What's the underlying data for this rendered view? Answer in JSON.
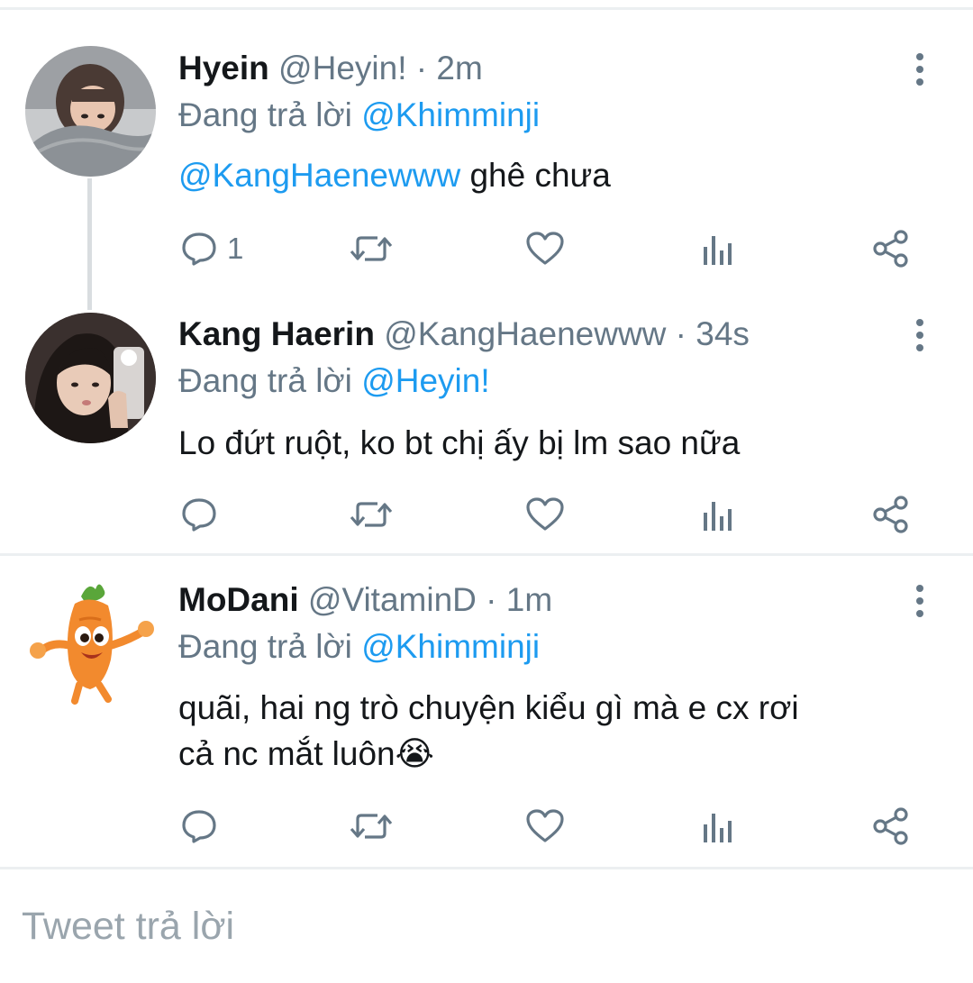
{
  "tweets": [
    {
      "name": "Hyein",
      "handle": "@Heyin!",
      "time": "2m",
      "replying_prefix": "Đang trả lời ",
      "replying_to": "@Khimminji",
      "mention": "@KangHaenewww",
      "text": " ghê chưa",
      "reply_count": "1"
    },
    {
      "name": "Kang Haerin",
      "handle": "@KangHaenewww",
      "time": "34s",
      "replying_prefix": "Đang trả lời ",
      "replying_to": "@Heyin!",
      "text": "Lo đứt ruột, ko bt chị ấy bị lm sao nữa",
      "reply_count": ""
    },
    {
      "name": "MoDani",
      "handle": "@VitaminD",
      "time": "1m",
      "replying_prefix": "Đang trả lời ",
      "replying_to": "@Khimminji",
      "text_line1": "quãi, hai ng trò chuyện kiểu gì mà e cx rơi",
      "text_line2": "cả nc mắt luôn",
      "emoji": "😭",
      "reply_count": ""
    }
  ],
  "separator": "·",
  "reply_input": {
    "placeholder": "Tweet trả lời"
  },
  "colors": {
    "accent": "#1d9bf0",
    "secondary_text": "#657786",
    "primary_text": "#14171a"
  },
  "icons": [
    "reply-icon",
    "retweet-icon",
    "like-icon",
    "analytics-icon",
    "share-icon",
    "more-vertical-icon"
  ]
}
